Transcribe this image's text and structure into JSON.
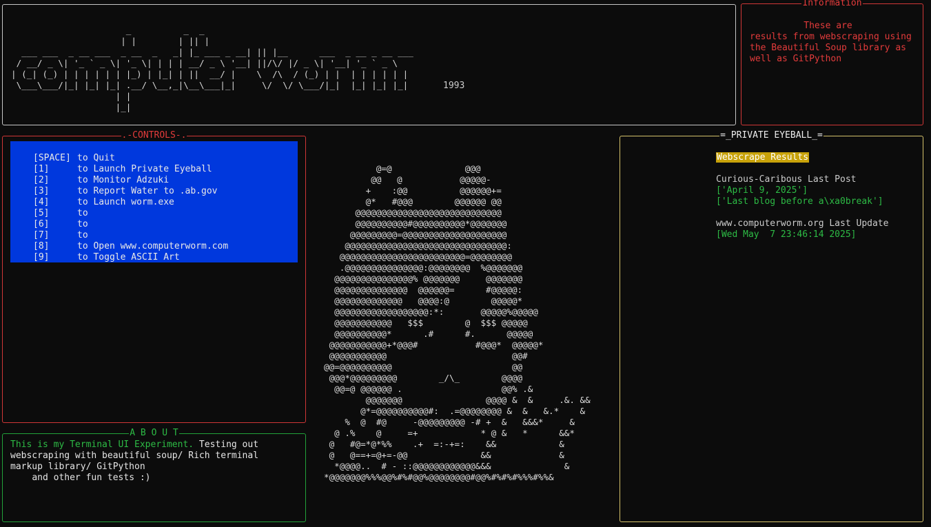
{
  "banner": {
    "art": [
      "                      _          _  _",
      "                     | |        | || |",
      "  ___ ___  _ __ ___  _ __  _   _| |_ ___ _ __| || |__      ___  _ __ _ __ ___",
      " / __/ _ \\| '_ ` _ \\| '_ \\| | | | __/ _ \\ '__| ||/\\/ |/ _ \\| '__| '_ ` _ \\",
      "| (_| (_) | | | | | | |_) | |_| | ||  __/ |    \\  /\\  / (_) | |  | | | | | |",
      " \\___\\___/|_| |_| |_| .__/ \\__,_|\\__\\___|_|     \\/  \\/ \\___/|_|  |_| |_| |_|",
      "                    | |",
      "                    |_|"
    ],
    "year": "1993"
  },
  "information": {
    "title": "Information",
    "text": "          These are\nresults from webscraping using\nthe Beautiful Soup library as\nwell as GitPython"
  },
  "controls": {
    "title": ".-CONTROLS-.",
    "rows": [
      {
        "key": "[SPACE]",
        "action": "to Quit"
      },
      {
        "key": "[1]",
        "action": "to Launch Private Eyeball"
      },
      {
        "key": "[2]",
        "action": "to Monitor Adzuki"
      },
      {
        "key": "[3]",
        "action": "to Report Water to .ab.gov"
      },
      {
        "key": "[4]",
        "action": "to Launch worm.exe"
      },
      {
        "key": "[5]",
        "action": "to"
      },
      {
        "key": "[6]",
        "action": "to"
      },
      {
        "key": "[7]",
        "action": "to"
      },
      {
        "key": "[8]",
        "action": "to Open www.computerworm.com"
      },
      {
        "key": "[9]",
        "action": "to Toggle ASCII Art"
      }
    ]
  },
  "about": {
    "title": "A B O U T",
    "highlight": "This is my Terminal UI Experiment.",
    "text": " Testing out\nwebscraping with beautiful soup/ Rich terminal\nmarkup library/ GitPython\n    and other fun tests :)"
  },
  "ascii_art": [
    "          @=@              @@@",
    "         @@   @           @@@@@-",
    "        +    :@@          @@@@@@+=",
    "        @*   #@@@        @@@@@@ @@",
    "      @@@@@@@@@@@@@@@@@@@@@@@@@@@@",
    "      @@@@@@@@@@#@@@@@@@@@@*@@@@@@@",
    "     @@@@@@@@@=@@@@@@@@@@@@@@@@@@@@",
    "    @@@@@@@@@@@@@@@@@@@@@@@@@@@@@@@:",
    "   @@@@@@@@@@@@@@@@@@@@@@@@=@@@@@@@@",
    "   .@@@@@@@@@@@@@@@:@@@@@@@@  %@@@@@@@",
    "  @@@@@@@@@@@@@@@% @@@@@@@     @@@@@@@",
    "  @@@@@@@@@@@@@@  @@@@@@=      #@@@@@:",
    "  @@@@@@@@@@@@@   @@@@:@        @@@@@*",
    "  @@@@@@@@@@@@@@@@@@:*:       @@@@@%@@@@@",
    "  @@@@@@@@@@@   $$$        @  $$$ @@@@@",
    "  @@@@@@@@@@*      .#      #.      @@@@@",
    " @@@@@@@@@@@+*@@@#           #@@@*  @@@@@*",
    " @@@@@@@@@@@                        @@#",
    "@@=@@@@@@@@@@                       @@",
    " @@@*@@@@@@@@@        _/\\_        @@@@",
    "  @@=@ @@@@@@ .                   @@% .&",
    "        @@@@@@@                @@@@ &  &     .&. &&",
    "       @*=@@@@@@@@@@#:  .=@@@@@@@@ &  &   &.*    &",
    "    %  @  #@     -@@@@@@@@@ -# +  &   &&&*     &",
    "  @ .%    @     =+            * @ &   *      &&*",
    " @   #@=*@*%%    .+  =:-+=:    &&            &",
    " @   @==+=@+=-@@              &&             &",
    "  *@@@@..  # - ::@@@@@@@@@@@@&&&              &",
    "*@@@@@@@%%%@@%#%#@@%@@@@@@@@#@@%#%#%#%%%#%%&"
  ],
  "eyeball": {
    "title": "=_PRIVATE EYEBALL_=",
    "heading": "Webscrape Results",
    "site1_label": "Curious-Caribous Last Post",
    "site1_date": "['April 9, 2025']",
    "site1_post": "['Last blog before a\\xa0break']",
    "site2_label": "www.computerworm.org Last Update",
    "site2_date": "[Wed May  7 23:46:14 2025]"
  },
  "colors": {
    "background": "#0c0c0c",
    "red": "#e33b3b",
    "green": "#2dbb45",
    "blue": "#0038dd",
    "yellow_border": "#d6c36b",
    "highlight": "#c8a20a"
  }
}
